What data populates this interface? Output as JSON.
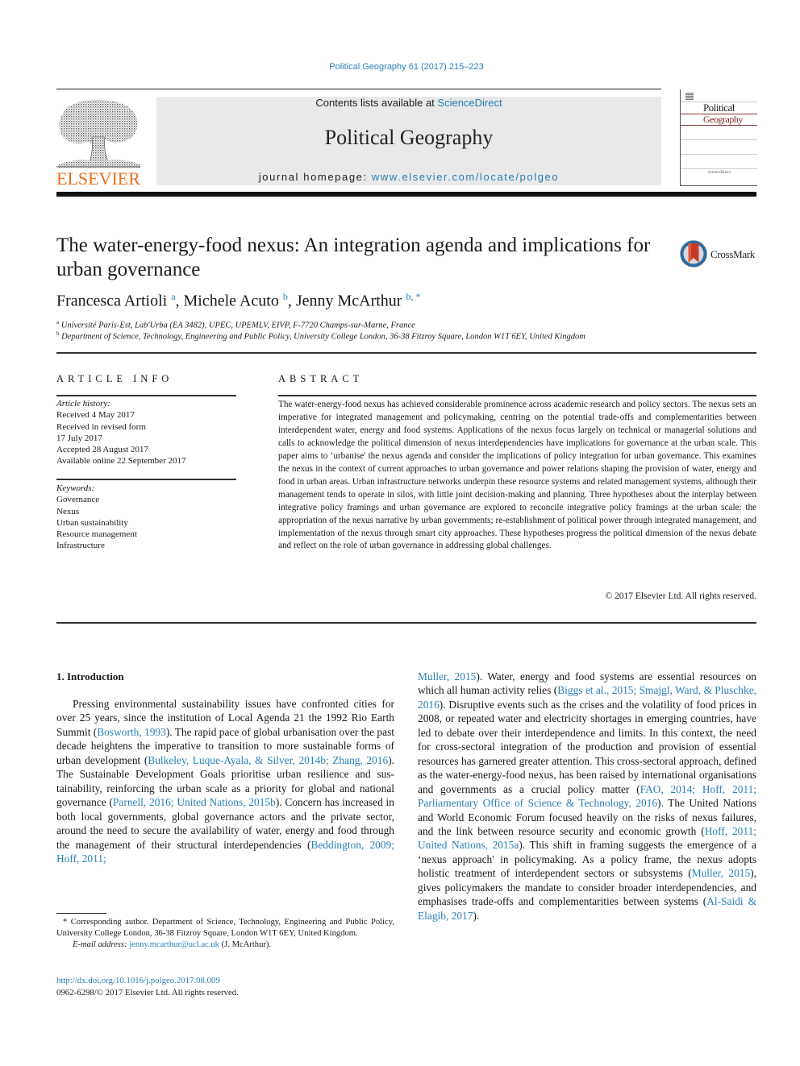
{
  "header": {
    "journal_ref": "Political Geography 61 (2017) 215–223",
    "contents_prefix": "Contents lists available at ",
    "contents_link": "ScienceDirect",
    "journal_title": "Political Geography",
    "homepage_prefix": "journal homepage: ",
    "homepage_link": "www.elsevier.com/locate/polgeo",
    "publisher": "ELSEVIER",
    "cover": {
      "line1": "Political",
      "line2": "Geography",
      "footer": "ScienceDirect"
    },
    "crossmark_label": "CrossMark",
    "colors": {
      "link": "#2a7fb5",
      "publisher_orange": "#e9711c",
      "banner_gray": "#e9e9e9"
    }
  },
  "article": {
    "title": "The water-energy-food nexus: An integration agenda and implications for urban governance",
    "authors": [
      {
        "name": "Francesca Artioli",
        "marks": "a"
      },
      {
        "name": "Michele Acuto",
        "marks": "b"
      },
      {
        "name": "Jenny McArthur",
        "marks": "b, *"
      }
    ],
    "separator": ", ",
    "affiliations": [
      {
        "mark": "a",
        "text": "Université Paris-Est, Lab'Urba (EA 3482), UPEC, UPEMLV, EIVP, F-7720 Champs-sur-Marne, France"
      },
      {
        "mark": "b",
        "text": "Department of Science, Technology, Engineering and Public Policy, University College London, 36-38 Fitzroy Square, London W1T 6EY, United Kingdom"
      }
    ]
  },
  "article_info": {
    "heading": "ARTICLE INFO",
    "history_label": "Article history:",
    "history": [
      "Received 4 May 2017",
      "Received in revised form",
      "17 July 2017",
      "Accepted 28 August 2017",
      "Available online 22 September 2017"
    ],
    "keywords_label": "Keywords:",
    "keywords": [
      "Governance",
      "Nexus",
      "Urban sustainability",
      "Resource management",
      "Infrastructure"
    ]
  },
  "abstract": {
    "heading": "ABSTRACT",
    "text": "The water-energy-food nexus has achieved considerable prominence across academic research and policy sectors. The nexus sets an imperative for integrated management and policymaking, centring on the potential trade-offs and complementarities between interdependent water, energy and food systems. Applications of the nexus focus largely on technical or managerial solutions and calls to acknowledge the political dimension of nexus interdependencies have implications for governance at the urban scale. This paper aims to ‘urbanise' the nexus agenda and consider the implications of policy integration for urban governance. This examines the nexus in the context of current approaches to urban governance and power relations shaping the provision of water, energy and food in urban areas. Urban infrastructure networks underpin these resource systems and related management systems, although their manage­ment tends to operate in silos, with little joint decision-making and planning. Three hypotheses about the interplay between integrative policy framings and urban governance are explored to reconcile integrative policy framings at the urban scale: the appropriation of the nexus narrative by urban gov­ernments; re-establishment of political power through integrated management, and implementation of the nexus through smart city approaches. These hypotheses progress the political dimension of the nexus debate and reflect on the role of urban governance in addressing global challenges.",
    "copyright": "© 2017 Elsevier Ltd. All rights reserved."
  },
  "body": {
    "section_heading": "1.  Introduction",
    "left_column": [
      {
        "t": "Pressing environmental sustainability issues have confronted cities for over 25 years, since the institution of Local Agenda 21 the 1992 Rio Earth Summit ("
      },
      {
        "t": "Bosworth, 1993",
        "link": true
      },
      {
        "t": "). The rapid pace of global urbanisation over the past decade heightens the imperative to transition to more sustainable forms of urban development ("
      },
      {
        "t": "Bulkeley, Luque-Ayala, & Silver, 2014b; Zhang, 2016",
        "link": true
      },
      {
        "t": "). The Sus­tainable Development Goals prioritise urban resilience and sus­tainability, reinforcing the urban scale as a priority for global and national governance ("
      },
      {
        "t": "Parnell, 2016; United Nations, 2015b",
        "link": true
      },
      {
        "t": "). Concern has increased in both local governments, global gover­nance actors and the private sector, around the need to secure the availability of water, energy and food through the management of their structural interdependencies ("
      },
      {
        "t": "Beddington, 2009; Hoff, 2011;",
        "link": true
      }
    ],
    "right_column": [
      {
        "t": "Muller, 2015",
        "link": true
      },
      {
        "t": "). Water, energy and food systems are essential re­sources on which all human activity relies ("
      },
      {
        "t": "Biggs et al., 2015; Smajgl, Ward, & Pluschke, 2016",
        "link": true
      },
      {
        "t": "). Disruptive events such as the crises and the volatility of food prices in 2008, or repeated water and electricity shortages in emerging countries, have led to debate over their interdependence and limits. In this context, the need for cross-sectoral integration of the production and provision of essential resources has garnered greater attention. This cross-sectoral approach, defined as the water-energy-food nexus, has been raised by international organisations and governments as a crucial policy matter ("
      },
      {
        "t": "FAO, 2014; Hoff, 2011; Parliamentary Office of Science & Technology, 2016",
        "link": true
      },
      {
        "t": "). The United Nations and World Eco­nomic Forum focused heavily on the risks of nexus failures, and the link between resource security and economic growth ("
      },
      {
        "t": "Hoff, 2011; United Nations, 2015a",
        "link": true
      },
      {
        "t": "). This shift in framing suggests the emer­gence of a ‘nexus approach' in policymaking. As a policy frame, the nexus adopts holistic treatment of interdependent sectors or sub­systems ("
      },
      {
        "t": "Muller, 2015",
        "link": true
      },
      {
        "t": "), gives policymakers the mandate to consider broader interdependencies, and emphasises trade-offs and com­plementarities between systems ("
      },
      {
        "t": "Al-Saidi & Elagib, 2017",
        "link": true
      },
      {
        "t": ")."
      }
    ]
  },
  "footnote": {
    "corresponding": "* Corresponding author. Department of Science, Technology, Engineering and Public Policy, University College London, 36-38 Fitzroy Square, London W1T 6EY, United Kingdom.",
    "email_label": "E-mail address: ",
    "email": "jenny.mcarthur@ucl.ac.uk",
    "email_suffix": " (J. McArthur).",
    "doi": "http://dx.doi.org/10.1016/j.polgeo.2017.08.009",
    "issn": "0962-6298/© 2017 Elsevier Ltd. All rights reserved."
  }
}
